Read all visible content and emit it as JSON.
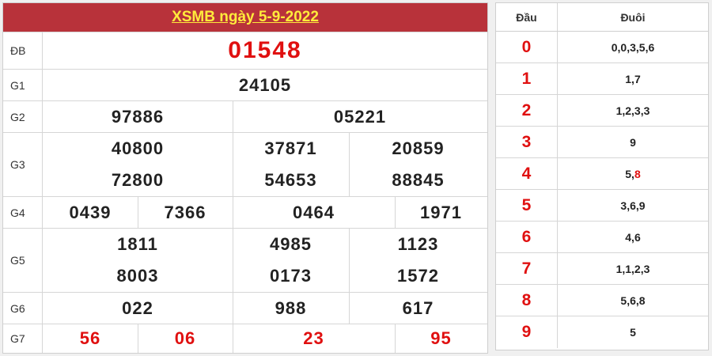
{
  "title": "XSMB ngày 5-9-2022",
  "rows": {
    "db": {
      "label": "ĐB",
      "values": [
        "01548"
      ]
    },
    "g1": {
      "label": "G1",
      "values": [
        "24105"
      ]
    },
    "g2": {
      "label": "G2",
      "values": [
        "97886",
        "05221"
      ]
    },
    "g3": {
      "label": "G3",
      "values": [
        "40800",
        "37871",
        "20859",
        "72800",
        "54653",
        "88845"
      ]
    },
    "g4": {
      "label": "G4",
      "values": [
        "0439",
        "7366",
        "0464",
        "1971"
      ]
    },
    "g5": {
      "label": "G5",
      "values": [
        "1811",
        "4985",
        "1123",
        "8003",
        "0173",
        "1572"
      ]
    },
    "g6": {
      "label": "G6",
      "values": [
        "022",
        "988",
        "617"
      ]
    },
    "g7": {
      "label": "G7",
      "values": [
        "56",
        "06",
        "23",
        "95"
      ]
    }
  },
  "loto": {
    "head_label": "Đầu",
    "tail_label": "Đuôi",
    "rows": [
      {
        "head": "0",
        "tail": "0,0,3,5,6"
      },
      {
        "head": "1",
        "tail": "1,7"
      },
      {
        "head": "2",
        "tail": "1,2,3,3"
      },
      {
        "head": "3",
        "tail": "9"
      },
      {
        "head": "4",
        "tail_a": "5,",
        "tail_b": "8"
      },
      {
        "head": "5",
        "tail": "3,6,9"
      },
      {
        "head": "6",
        "tail": "4,6"
      },
      {
        "head": "7",
        "tail": "1,1,2,3"
      },
      {
        "head": "8",
        "tail": "5,6,8"
      },
      {
        "head": "9",
        "tail": "5"
      }
    ]
  },
  "colors": {
    "title_bg": "#b8323a",
    "title_text": "#ffeb3b",
    "highlight": "#e01010"
  }
}
